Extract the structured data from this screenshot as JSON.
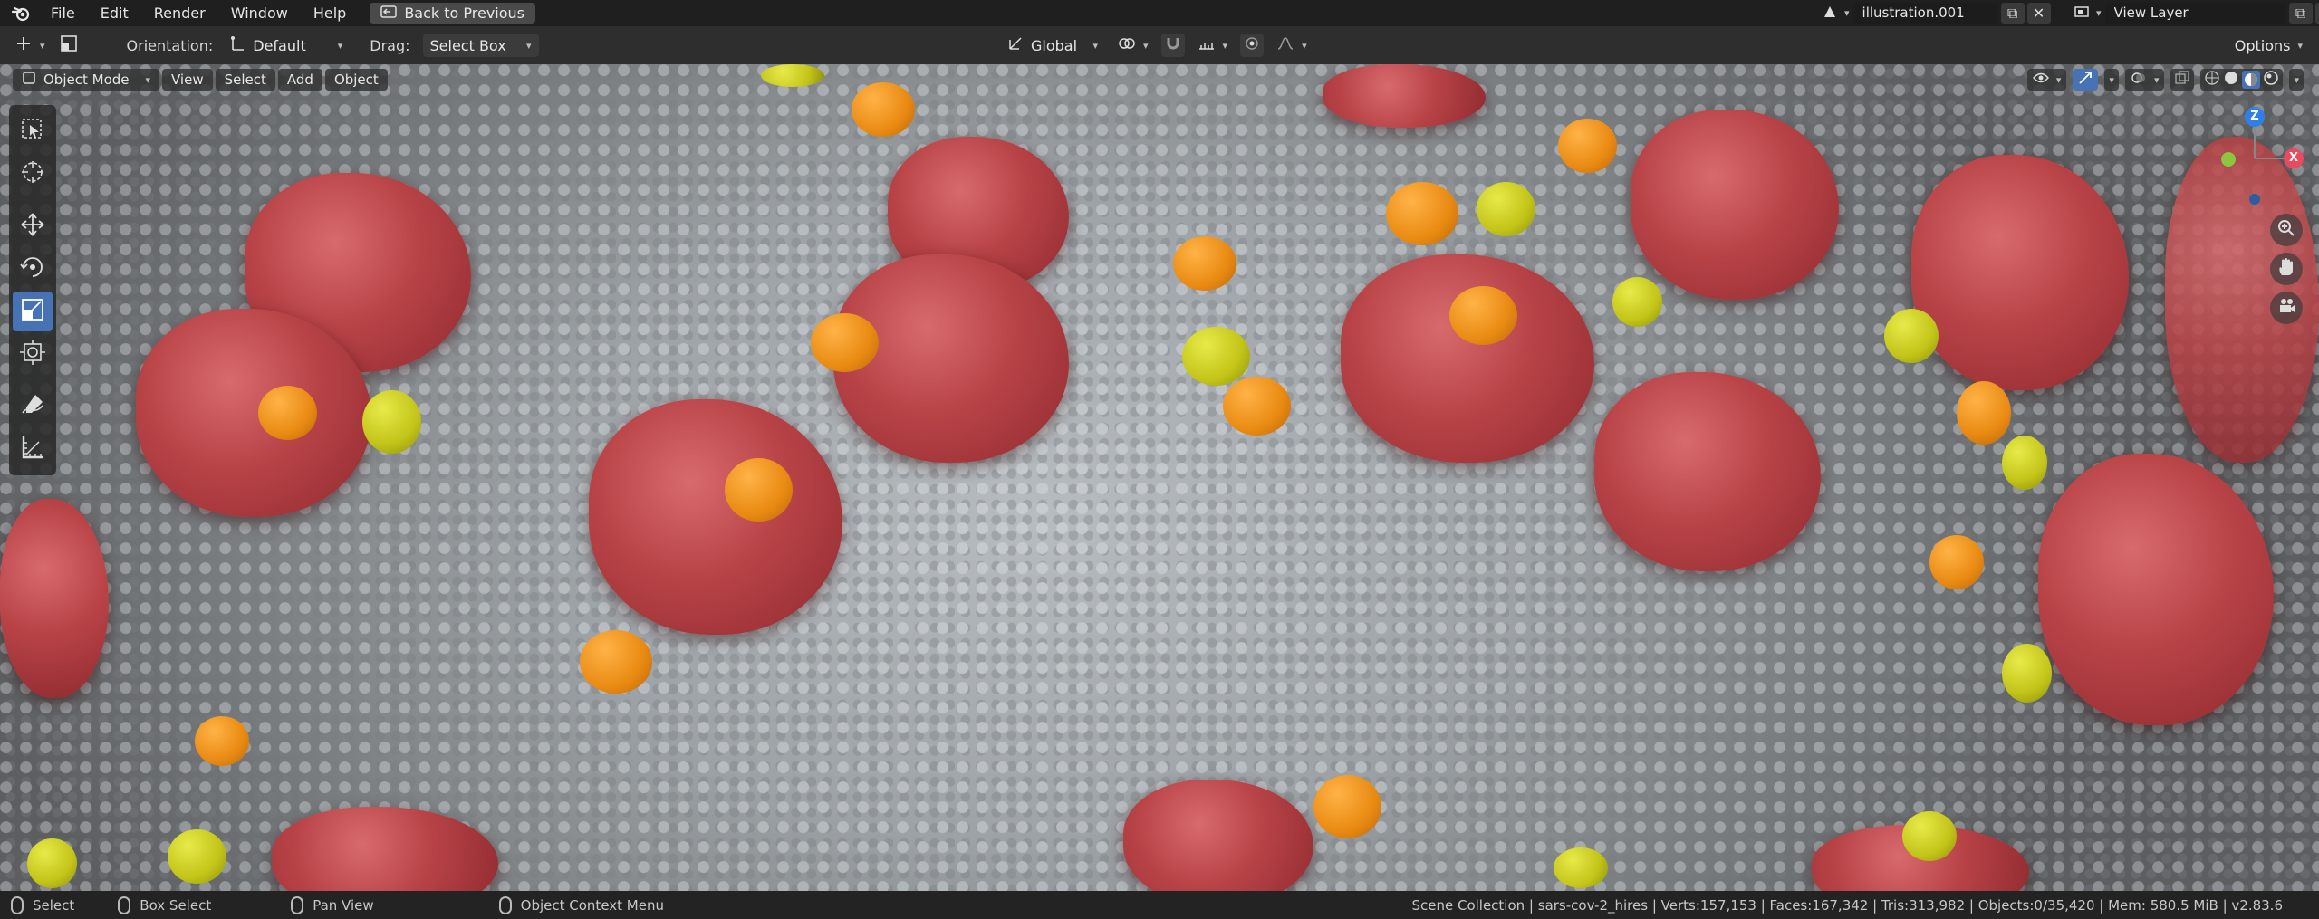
{
  "topbar": {
    "menus": [
      "File",
      "Edit",
      "Render",
      "Window",
      "Help"
    ],
    "back_button": "Back to Previous",
    "scene_name": "illustration.001",
    "view_layer": "View Layer"
  },
  "tool_header": {
    "orientation_label": "Orientation:",
    "orientation_value": "Default",
    "drag_label": "Drag:",
    "drag_value": "Select Box",
    "transform_orientation": "Global",
    "options_label": "Options"
  },
  "viewport_header": {
    "mode": "Object Mode",
    "menus": [
      "View",
      "Select",
      "Add",
      "Object"
    ]
  },
  "gizmo": {
    "z_label": "Z",
    "x_label": "X"
  },
  "statusbar": {
    "select": "Select",
    "box_select": "Box Select",
    "pan_view": "Pan View",
    "context_menu": "Object Context Menu",
    "stats": "Scene Collection | sars-cov-2_hires | Verts:157,153 | Faces:167,342 | Tris:313,982 | Objects:0/35,420 | Mem: 580.5 MiB | v2.83.6"
  },
  "colors": {
    "active_tool": "#4772b3",
    "spike_red": "#b84347",
    "protein_orange": "#e98a12",
    "protein_yellow": "#c2c418"
  }
}
